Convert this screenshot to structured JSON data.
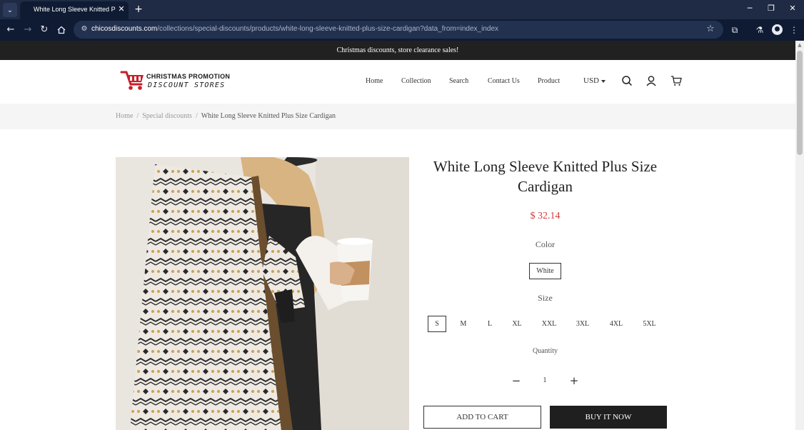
{
  "browser": {
    "tab_title": "White Long Sleeve Knitted Plus Size Cardigan",
    "url_domain": "chicosdiscounts.com",
    "url_path": "/collections/special-discounts/products/white-long-sleeve-knitted-plus-size-cardigan?data_from=index_index"
  },
  "announcement": "Christmas discounts, store clearance sales!",
  "brand": {
    "line1": "CHRISTMAS PROMOTION",
    "line2": "DISCOUNT STORES",
    "logo_color": "#c81e2a"
  },
  "nav": [
    {
      "label": "Home"
    },
    {
      "label": "Collection"
    },
    {
      "label": "Search"
    },
    {
      "label": "Contact Us"
    },
    {
      "label": "Product"
    }
  ],
  "currency": "USD",
  "breadcrumb": {
    "items": [
      "Home",
      "Special discounts"
    ],
    "current": "White Long Sleeve Knitted Plus Size Cardigan",
    "separator": "/"
  },
  "product": {
    "title": "White Long Sleeve Knitted Plus Size Cardigan",
    "price": "$ 32.14",
    "price_color": "#d33a3a",
    "color_label": "Color",
    "colors": [
      "White"
    ],
    "selected_color": "White",
    "size_label": "Size",
    "sizes": [
      "S",
      "M",
      "L",
      "XL",
      "XXL",
      "3XL",
      "4XL",
      "5XL"
    ],
    "selected_size": "S",
    "quantity_label": "Quantity",
    "quantity": "1",
    "add_to_cart": "ADD TO CART",
    "buy_now": "BUY IT NOW"
  }
}
